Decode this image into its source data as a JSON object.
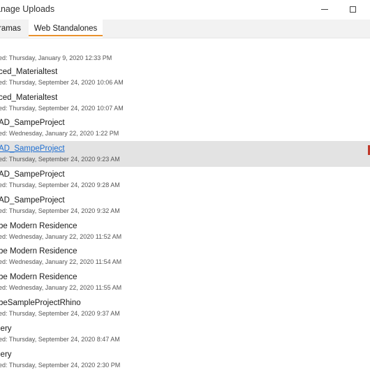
{
  "window": {
    "title": "anage Uploads"
  },
  "tabs": [
    {
      "label": "ramas"
    },
    {
      "label": "Web Standalones"
    }
  ],
  "uploads": [
    {
      "name": "",
      "date": "ed: Thursday, January 9, 2020 12:33 PM"
    },
    {
      "name": "ced_Materialtest",
      "date": "ed: Thursday, September 24, 2020 10:06 AM"
    },
    {
      "name": "ced_Materialtest",
      "date": "ed: Thursday, September 24, 2020 10:07 AM"
    },
    {
      "name": "AD_SampeProject",
      "date": "ed: Wednesday, January 22, 2020 1:22 PM"
    },
    {
      "name": "AD_SampeProject",
      "date": "ed: Thursday, September 24, 2020 9:23 AM"
    },
    {
      "name": "AD_SampeProject",
      "date": "ed: Thursday, September 24, 2020 9:28 AM"
    },
    {
      "name": "AD_SampeProject",
      "date": "ed: Thursday, September 24, 2020 9:32 AM"
    },
    {
      "name": "be Modern Residence",
      "date": "ed: Wednesday, January 22, 2020 11:52 AM"
    },
    {
      "name": "be Modern Residence",
      "date": "ed: Wednesday, January 22, 2020 11:54 AM"
    },
    {
      "name": "be Modern Residence",
      "date": "ed: Wednesday, January 22, 2020 11:55 AM"
    },
    {
      "name": "beSampleProjectRhino",
      "date": "ed: Thursday, September 24, 2020 9:37 AM"
    },
    {
      "name": "lery",
      "date": "ed: Thursday, September 24, 2020 8:47 AM"
    },
    {
      "name": "lery",
      "date": "ed: Thursday, September 24, 2020 2:30 PM"
    }
  ],
  "colors": {
    "accent": "#e8912d",
    "selected_row": "#e3e3e3",
    "link": "#1f6fd1"
  }
}
